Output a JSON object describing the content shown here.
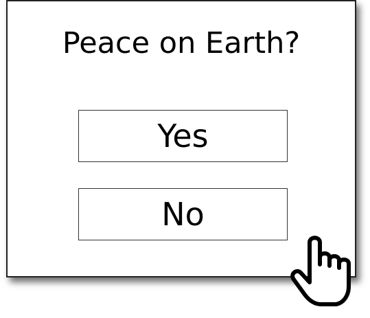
{
  "dialog": {
    "question": "Peace on Earth?",
    "options": [
      {
        "label": "Yes"
      },
      {
        "label": "No"
      }
    ]
  },
  "cursor": {
    "icon": "hand-pointer-icon",
    "hovering": "No"
  }
}
